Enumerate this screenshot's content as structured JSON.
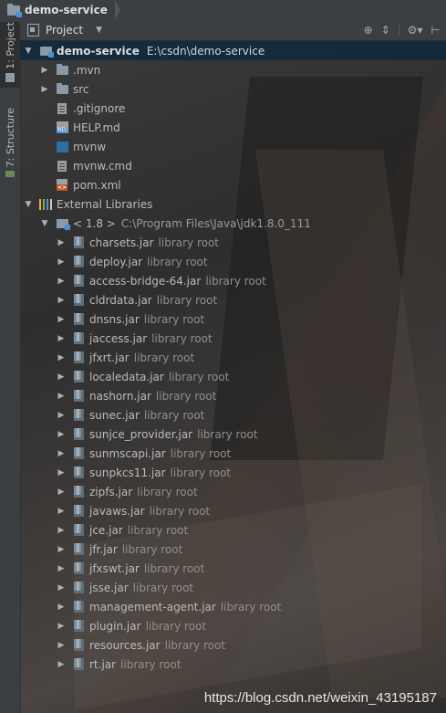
{
  "breadcrumb": {
    "project": "demo-service"
  },
  "side_tabs": [
    {
      "label": "1: Project",
      "active": true
    },
    {
      "label": "7: Structure",
      "active": false
    }
  ],
  "header": {
    "view_label": "Project",
    "tools": [
      "target-icon",
      "collapse-icon",
      "gear-icon",
      "hide-icon"
    ]
  },
  "tree": {
    "root": {
      "name": "demo-service",
      "path": "E:\\csdn\\demo-service",
      "expanded": true
    },
    "children": [
      {
        "name": ".mvn",
        "type": "folder",
        "expandable": true
      },
      {
        "name": "src",
        "type": "folder",
        "expandable": true
      },
      {
        "name": ".gitignore",
        "type": "text",
        "expandable": false
      },
      {
        "name": "HELP.md",
        "type": "md",
        "expandable": false
      },
      {
        "name": "mvnw",
        "type": "shell",
        "expandable": false
      },
      {
        "name": "mvnw.cmd",
        "type": "text",
        "expandable": false
      },
      {
        "name": "pom.xml",
        "type": "maven",
        "expandable": false
      }
    ],
    "external_libraries": {
      "label": "External Libraries",
      "jdk": {
        "name": "< 1.8 >",
        "path": "C:\\Program Files\\Java\\jdk1.8.0_111"
      },
      "lib_root_label": "library root",
      "jars": [
        "charsets.jar",
        "deploy.jar",
        "access-bridge-64.jar",
        "cldrdata.jar",
        "dnsns.jar",
        "jaccess.jar",
        "jfxrt.jar",
        "localedata.jar",
        "nashorn.jar",
        "sunec.jar",
        "sunjce_provider.jar",
        "sunmscapi.jar",
        "sunpkcs11.jar",
        "zipfs.jar",
        "javaws.jar",
        "jce.jar",
        "jfr.jar",
        "jfxswt.jar",
        "jsse.jar",
        "management-agent.jar",
        "plugin.jar",
        "resources.jar",
        "rt.jar"
      ]
    }
  },
  "watermark": "https://blog.csdn.net/weixin_43195187"
}
